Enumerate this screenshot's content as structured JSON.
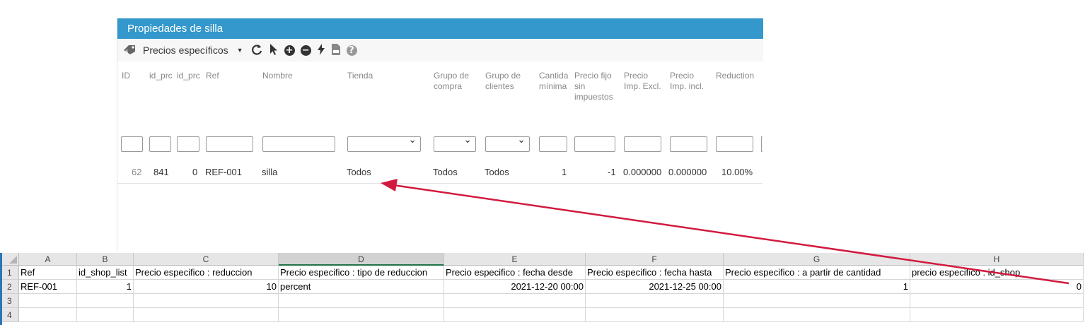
{
  "panel": {
    "title": "Propiedades de silla",
    "toolbar": {
      "dropdown_label": "Precios específicos"
    },
    "columns": {
      "id": "ID",
      "id_product": "id_prc",
      "id_product_attr": "id_prc",
      "ref": "Ref",
      "nombre": "Nombre",
      "tienda": "Tienda",
      "grupo_compra": [
        "Grupo de",
        "compra"
      ],
      "grupo_clientes": [
        "Grupo de",
        "clientes"
      ],
      "cantidad": [
        "Cantida",
        "mínima"
      ],
      "precio_fijo": [
        "Precio fijo",
        "sin",
        "impuestos"
      ],
      "precio_excl": [
        "Precio",
        "Imp. Excl."
      ],
      "precio_incl": [
        "Precio",
        "Imp. incl."
      ],
      "reduction": "Reduction"
    },
    "row": {
      "id": "62",
      "id_product": "841",
      "id_product_attr": "0",
      "ref": "REF-001",
      "nombre": "silla",
      "tienda": "Todos",
      "grupo_compra": "Todos",
      "grupo_clientes": "Todos",
      "cantidad": "1",
      "precio_fijo": "-1",
      "precio_excl": "0.000000",
      "precio_incl": "0.000000",
      "reduction": "10.00%"
    }
  },
  "sheet": {
    "col_letters": [
      "A",
      "B",
      "C",
      "D",
      "E",
      "F",
      "G",
      "H"
    ],
    "row_numbers": [
      "1",
      "2",
      "3",
      "4"
    ],
    "headers": [
      "Ref",
      "id_shop_list",
      "Precio especifico : reduccion",
      "Precio especifico : tipo de reduccion",
      "Precio especifico : fecha desde",
      "Precio especifico : fecha hasta",
      "Precio especifico : a partir de cantidad",
      "precio especifico : id_shop"
    ],
    "row2": [
      "REF-001",
      "1",
      "10",
      "percent",
      "2021-12-20 00:00",
      "2021-12-25 00:00",
      "1",
      "0"
    ]
  },
  "colors": {
    "panel_header": "#3498cc",
    "arrow": "#d11a3f",
    "excel_green": "#217346"
  }
}
